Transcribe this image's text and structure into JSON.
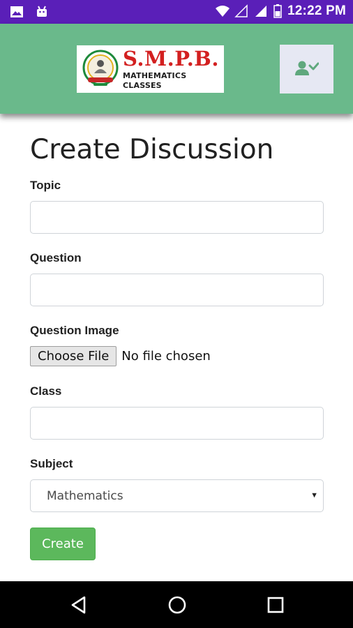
{
  "status_bar": {
    "time": "12:22 PM",
    "left_icons": [
      "gallery-icon",
      "android-icon"
    ],
    "right_icons": [
      "wifi-icon",
      "signal-empty-icon",
      "signal-icon",
      "battery-icon"
    ],
    "background": "#5a1fb8"
  },
  "header": {
    "logo": {
      "brand": "S.M.P.B.",
      "subtitle": "MATHEMATICS CLASSES"
    },
    "user_menu_icon": "user-check-icon",
    "background": "#6ab98b"
  },
  "form": {
    "title": "Create Discussion",
    "topic_label": "Topic",
    "topic_value": "",
    "question_label": "Question",
    "question_value": "",
    "image_label": "Question Image",
    "choose_file_label": "Choose File",
    "file_status": "No file chosen",
    "class_label": "Class",
    "class_value": "",
    "subject_label": "Subject",
    "subject_value": "Mathematics",
    "create_label": "Create",
    "accent": "#5cb85c"
  },
  "nav_bar": {
    "buttons": [
      "back-icon",
      "home-icon",
      "recents-icon"
    ]
  }
}
